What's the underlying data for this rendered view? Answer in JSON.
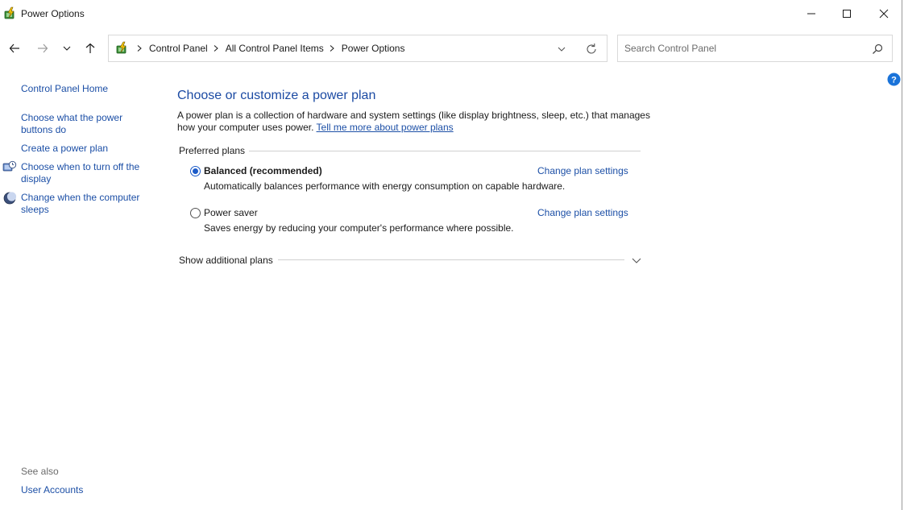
{
  "window": {
    "title": "Power Options"
  },
  "address": {
    "crumbs": [
      "Control Panel",
      "All Control Panel Items",
      "Power Options"
    ]
  },
  "search": {
    "placeholder": "Search Control Panel",
    "value": ""
  },
  "sidebar": {
    "home": "Control Panel Home",
    "links": [
      {
        "label": "Choose what the power buttons do",
        "icon": ""
      },
      {
        "label": "Create a power plan",
        "icon": ""
      },
      {
        "label": "Choose when to turn off the display",
        "icon": "monitor-clock-icon"
      },
      {
        "label": "Change when the computer sleeps",
        "icon": "moon-icon"
      }
    ],
    "see_also": "See also",
    "see_also_links": [
      "User Accounts"
    ]
  },
  "main": {
    "heading": "Choose or customize a power plan",
    "description": "A power plan is a collection of hardware and system settings (like display brightness, sleep, etc.) that manages how your computer uses power.",
    "learn_more": "Tell me more about power plans",
    "preferred_label": "Preferred plans",
    "plans": [
      {
        "name": "Balanced (recommended)",
        "description": "Automatically balances performance with energy consumption on capable hardware.",
        "selected": true,
        "link": "Change plan settings"
      },
      {
        "name": "Power saver",
        "description": "Saves energy by reducing your computer's performance where possible.",
        "selected": false,
        "link": "Change plan settings"
      }
    ],
    "additional_label": "Show additional plans"
  },
  "colors": {
    "link": "#1c4fa6",
    "heading": "#1b4aa3",
    "radio_accent": "#1c5bc8"
  }
}
